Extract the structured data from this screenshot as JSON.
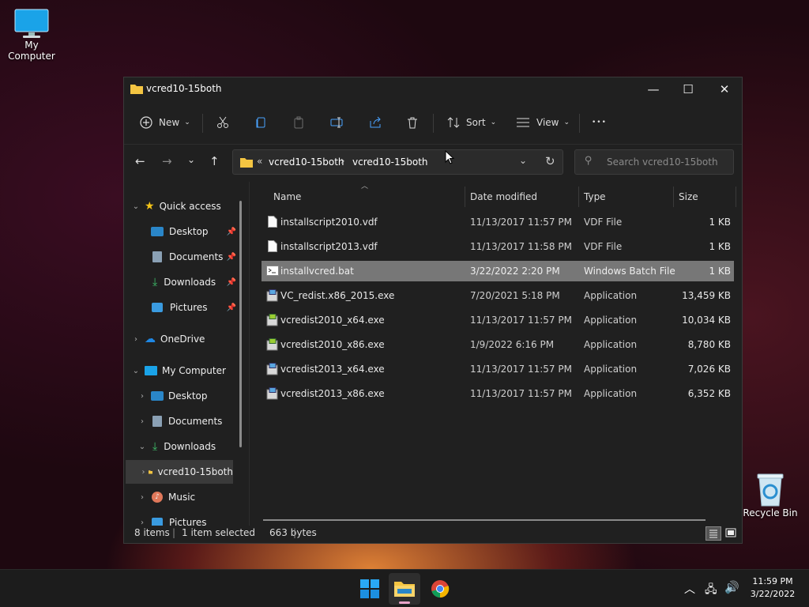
{
  "desktop": {
    "my_computer": "My Computer",
    "recycle_bin": "Recycle Bin"
  },
  "window": {
    "title": "vcred10-15both",
    "controls": {
      "minimize": "—",
      "maximize": "☐",
      "close": "✕"
    }
  },
  "toolbar": {
    "new_label": "New",
    "sort_label": "Sort",
    "view_label": "View",
    "more_label": "•••"
  },
  "address": {
    "overflow": "«",
    "crumbs": [
      "vcred10-15both",
      "vcred10-15both"
    ],
    "separator": "›"
  },
  "search": {
    "placeholder": "Search vcred10-15both"
  },
  "sidebar": {
    "items": [
      {
        "label": "Quick access"
      },
      {
        "label": "Desktop"
      },
      {
        "label": "Documents"
      },
      {
        "label": "Downloads"
      },
      {
        "label": "Pictures"
      },
      {
        "label": "OneDrive"
      },
      {
        "label": "My Computer"
      },
      {
        "label": "Desktop"
      },
      {
        "label": "Documents"
      },
      {
        "label": "Downloads"
      },
      {
        "label": "vcred10-15both"
      },
      {
        "label": "Music"
      },
      {
        "label": "Pictures"
      }
    ]
  },
  "columns": {
    "name": "Name",
    "date": "Date modified",
    "type": "Type",
    "size": "Size"
  },
  "files": [
    {
      "name": "installscript2010.vdf",
      "date": "11/13/2017 11:57 PM",
      "type": "VDF File",
      "size": "1 KB"
    },
    {
      "name": "installscript2013.vdf",
      "date": "11/13/2017 11:58 PM",
      "type": "VDF File",
      "size": "1 KB"
    },
    {
      "name": "installvcred.bat",
      "date": "3/22/2022 2:20 PM",
      "type": "Windows Batch File",
      "size": "1 KB"
    },
    {
      "name": "VC_redist.x86_2015.exe",
      "date": "7/20/2021 5:18 PM",
      "type": "Application",
      "size": "13,459 KB"
    },
    {
      "name": "vcredist2010_x64.exe",
      "date": "11/13/2017 11:57 PM",
      "type": "Application",
      "size": "10,034 KB"
    },
    {
      "name": "vcredist2010_x86.exe",
      "date": "1/9/2022 6:16 PM",
      "type": "Application",
      "size": "8,780 KB"
    },
    {
      "name": "vcredist2013_x64.exe",
      "date": "11/13/2017 11:57 PM",
      "type": "Application",
      "size": "7,026 KB"
    },
    {
      "name": "vcredist2013_x86.exe",
      "date": "11/13/2017 11:57 PM",
      "type": "Application",
      "size": "6,352 KB"
    }
  ],
  "status": {
    "count": "8 items",
    "selection": "1 item selected",
    "size": "663 bytes"
  },
  "clock": {
    "time": "11:59 PM",
    "date": "3/22/2022"
  },
  "colors": {
    "window_bg": "#202020",
    "selected_row": "#777777",
    "folder": "#f4c542",
    "accent": "#0078d4"
  }
}
